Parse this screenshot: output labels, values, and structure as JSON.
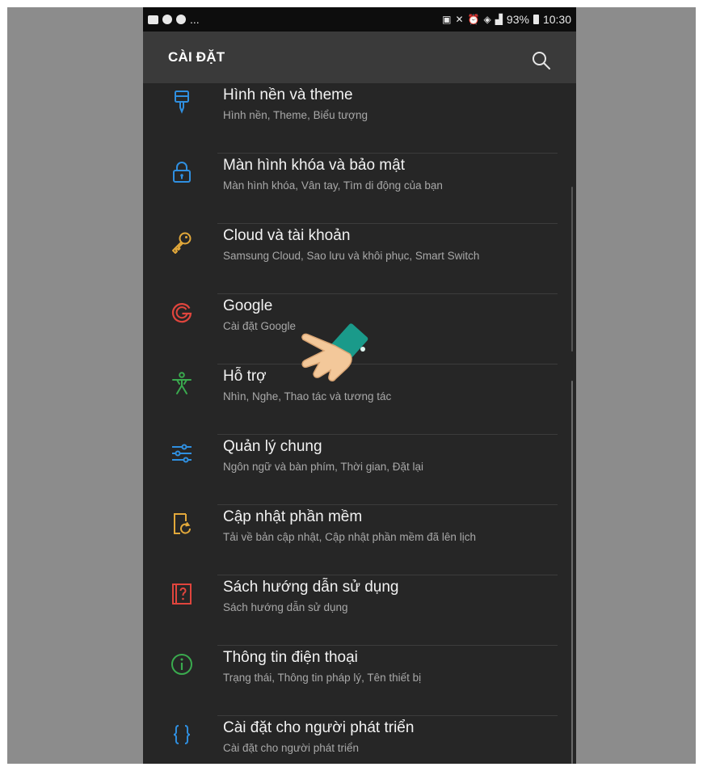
{
  "status_bar": {
    "left_extra": "...",
    "battery": "93%",
    "time": "10:30"
  },
  "appbar": {
    "title": "CÀI ĐẶT"
  },
  "items": [
    {
      "title": "Hình nền và theme",
      "subtitle": "Hình nền, Theme, Biểu tượng",
      "icon": "paintbrush-icon",
      "color": "#2f8fe0"
    },
    {
      "title": "Màn hình khóa và bảo mật",
      "subtitle": "Màn hình khóa, Vân tay, Tìm di động của bạn",
      "icon": "lock-icon",
      "color": "#2f8fe0"
    },
    {
      "title": "Cloud và tài khoản",
      "subtitle": "Samsung Cloud, Sao lưu và khôi phục, Smart Switch",
      "icon": "key-icon",
      "color": "#e2a83a"
    },
    {
      "title": "Google",
      "subtitle": "Cài đặt Google",
      "icon": "google-icon",
      "color": "#e0453d"
    },
    {
      "title": "Hỗ trợ",
      "subtitle": "Nhìn, Nghe, Thao tác và tương tác",
      "icon": "accessibility-icon",
      "color": "#3aaa4e"
    },
    {
      "title": "Quản lý chung",
      "subtitle": "Ngôn ngữ và bàn phím, Thời gian, Đặt lại",
      "icon": "sliders-icon",
      "color": "#2f8fe0"
    },
    {
      "title": "Cập nhật phần mềm",
      "subtitle": "Tải về bản cập nhật, Cập nhật phần mềm đã lên lịch",
      "icon": "update-icon",
      "color": "#e2a83a"
    },
    {
      "title": "Sách hướng dẫn sử dụng",
      "subtitle": "Sách hướng dẫn sử dụng",
      "icon": "help-book-icon",
      "color": "#e0453d"
    },
    {
      "title": "Thông tin điện thoại",
      "subtitle": "Trạng thái, Thông tin pháp lý, Tên thiết bị",
      "icon": "info-icon",
      "color": "#3aaa4e"
    },
    {
      "title": "Cài đặt cho người phát triển",
      "subtitle": "Cài đặt cho người phát triển",
      "icon": "braces-icon",
      "color": "#2f8fe0"
    }
  ]
}
